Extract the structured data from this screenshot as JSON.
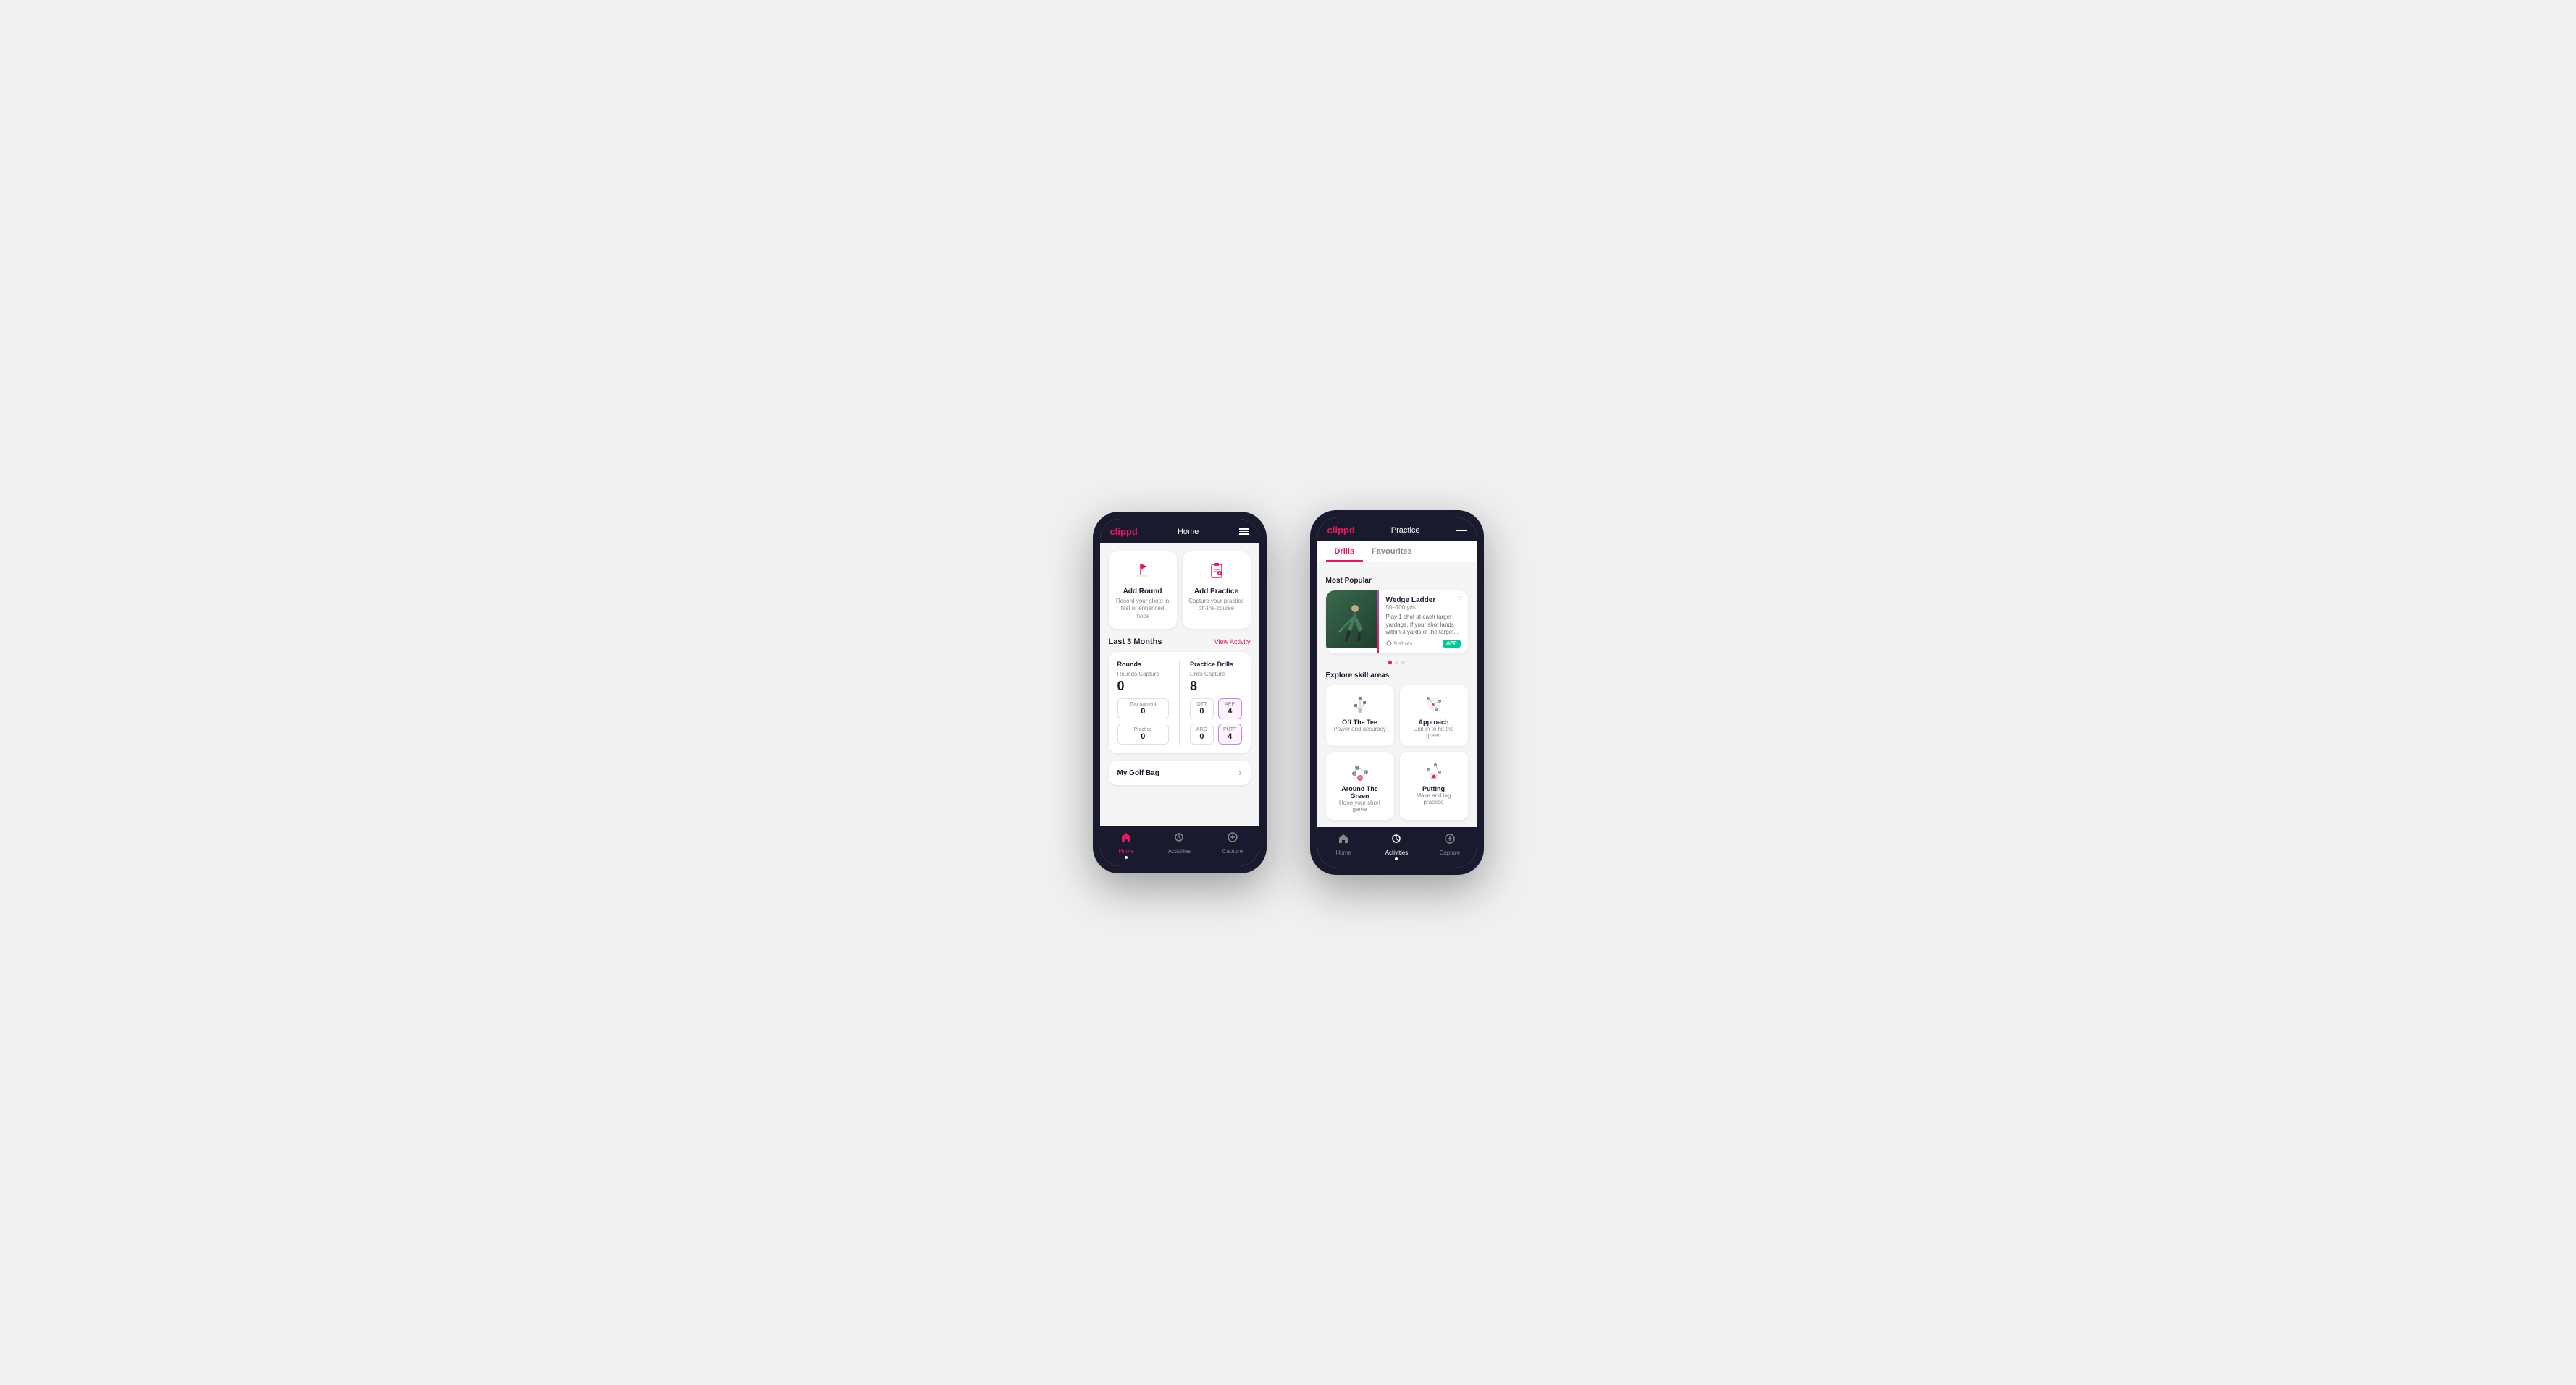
{
  "phone1": {
    "header": {
      "logo": "clippd",
      "title": "Home"
    },
    "quickActions": [
      {
        "id": "add-round",
        "icon": "🏌️",
        "title": "Add Round",
        "desc": "Record your shots in fast or enhanced mode"
      },
      {
        "id": "add-practice",
        "icon": "📋",
        "title": "Add Practice",
        "desc": "Capture your practice off-the-course"
      }
    ],
    "lastMonths": {
      "label": "Last 3 Months",
      "viewLink": "View Activity"
    },
    "stats": {
      "rounds": {
        "title": "Rounds",
        "captureLabel": "Rounds Capture",
        "total": "0",
        "rows": [
          {
            "label": "Tournament",
            "value": "0"
          },
          {
            "label": "Practice",
            "value": "0"
          }
        ]
      },
      "practice": {
        "title": "Practice Drills",
        "captureLabel": "Drills Capture",
        "total": "8",
        "grid": [
          {
            "label": "OTT",
            "value": "0"
          },
          {
            "label": "APP",
            "value": "4",
            "highlight": true
          },
          {
            "label": "ARG",
            "value": "0"
          },
          {
            "label": "PUTT",
            "value": "4",
            "highlight": true
          }
        ]
      }
    },
    "golfBag": {
      "label": "My Golf Bag"
    },
    "nav": [
      {
        "label": "Home",
        "icon": "🏠",
        "active": true
      },
      {
        "label": "Activities",
        "icon": "⚡",
        "active": false
      },
      {
        "label": "Capture",
        "icon": "➕",
        "active": false
      }
    ]
  },
  "phone2": {
    "header": {
      "logo": "clippd",
      "title": "Practice"
    },
    "tabs": [
      {
        "label": "Drills",
        "active": true
      },
      {
        "label": "Favourites",
        "active": false
      }
    ],
    "mostPopular": {
      "label": "Most Popular",
      "drill": {
        "title": "Wedge Ladder",
        "yardage": "50–100 yds",
        "desc": "Play 1 shot at each target yardage. If your shot lands within 3 yards of the target...",
        "shots": "9 shots",
        "badge": "APP"
      }
    },
    "skillAreas": {
      "label": "Explore skill areas",
      "items": [
        {
          "id": "off-tee",
          "name": "Off The Tee",
          "desc": "Power and accuracy",
          "iconType": "tee"
        },
        {
          "id": "approach",
          "name": "Approach",
          "desc": "Dial-in to hit the green",
          "iconType": "approach"
        },
        {
          "id": "around-green",
          "name": "Around The Green",
          "desc": "Hone your short game",
          "iconType": "around-green"
        },
        {
          "id": "putting",
          "name": "Putting",
          "desc": "Make and lag practice",
          "iconType": "putting"
        }
      ]
    },
    "nav": [
      {
        "label": "Home",
        "icon": "🏠",
        "active": false
      },
      {
        "label": "Activities",
        "icon": "⚡",
        "active": true
      },
      {
        "label": "Capture",
        "icon": "➕",
        "active": false
      }
    ]
  }
}
